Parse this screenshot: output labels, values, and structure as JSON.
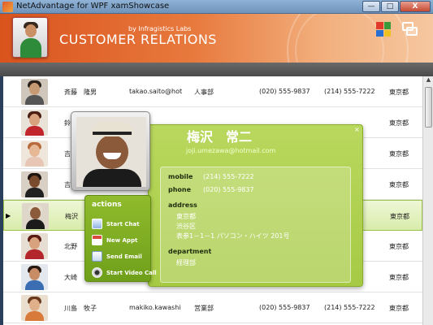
{
  "window": {
    "title": "NetAdvantage for WPF xamShowcase",
    "controls": [
      "—",
      "□",
      "X"
    ]
  },
  "header": {
    "byline": "by Infragistics Labs",
    "title": "CUSTOMER RELATIONS"
  },
  "colors": {
    "accent_orange": "#e2642b",
    "card_green": "#a6ca44",
    "palette": [
      "#e03a2a",
      "#3a9a3a",
      "#2a6fd0",
      "#f0c020"
    ]
  },
  "rows": [
    {
      "name": "斉藤　隆男",
      "email": "takao.saito@hot",
      "dept": "人事部",
      "phone1": "(020) 555-9837",
      "phone2": "(214) 555-7222",
      "city": "東京都",
      "selected": false
    },
    {
      "name": "鈴",
      "email": "",
      "dept": "",
      "phone1": "",
      "phone2": "",
      "city": "東京都",
      "selected": false
    },
    {
      "name": "吉",
      "email": "",
      "dept": "",
      "phone1": "",
      "phone2": "",
      "city": "東京都",
      "selected": false
    },
    {
      "name": "吉",
      "email": "",
      "dept": "",
      "phone1": "",
      "phone2": "",
      "city": "東京都",
      "selected": false
    },
    {
      "name": "梅沢",
      "email": "",
      "dept": "",
      "phone1": "",
      "phone2": "",
      "city": "東京都",
      "selected": true
    },
    {
      "name": "北野",
      "email": "",
      "dept": "",
      "phone1": "",
      "phone2": "",
      "city": "東京都",
      "selected": false
    },
    {
      "name": "大崎",
      "email": "",
      "dept": "",
      "phone1": "",
      "phone2": "",
      "city": "東京都",
      "selected": false
    },
    {
      "name": "川島　牧子",
      "email": "makiko.kawashi",
      "dept": "営業部",
      "phone1": "(020) 555-9837",
      "phone2": "(214) 555-7222",
      "city": "東京都",
      "selected": false
    }
  ],
  "card": {
    "name": "梅沢　常二",
    "email": "joji.umezawa@hotmail.com",
    "mobile_label": "mobile",
    "mobile": "(214) 555-7222",
    "phone_label": "phone",
    "phone": "(020) 555-9837",
    "address_label": "address",
    "address_lines": [
      "東京都",
      "渋谷区",
      "表参1－1－1 パソコン・ハイツ 201号"
    ],
    "department_label": "department",
    "department": "経理部",
    "close": "×"
  },
  "actions": {
    "header": "actions",
    "items": [
      {
        "label": "Start Chat",
        "icon": "chat-icon"
      },
      {
        "label": "New Appt",
        "icon": "calendar-icon"
      },
      {
        "label": "Send Email",
        "icon": "email-icon"
      },
      {
        "label": "Start Video Call",
        "icon": "video-call-icon"
      }
    ]
  }
}
